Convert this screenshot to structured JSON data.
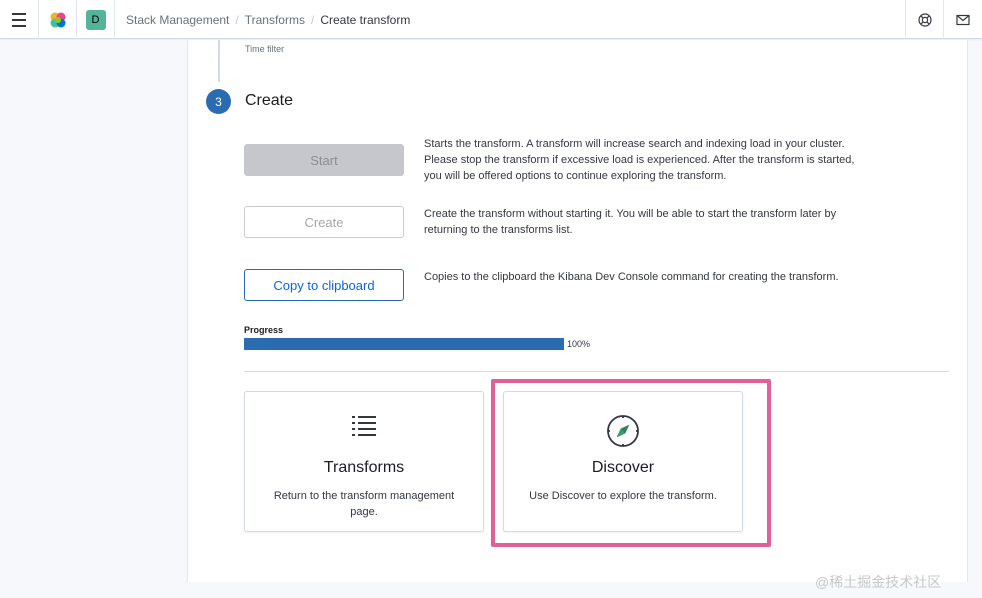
{
  "header": {
    "space_initial": "D",
    "breadcrumbs": [
      "Stack Management",
      "Transforms",
      "Create transform"
    ]
  },
  "steps": {
    "previous_label": "Time filter",
    "current_number": "3",
    "current_title": "Create"
  },
  "actions": {
    "start": {
      "label": "Start",
      "description": "Starts the transform. A transform will increase search and indexing load in your cluster. Please stop the transform if excessive load is experienced. After the transform is started, you will be offered options to continue exploring the transform."
    },
    "create": {
      "label": "Create",
      "description": "Create the transform without starting it. You will be able to start the transform later by returning to the transforms list."
    },
    "copy": {
      "label": "Copy to clipboard",
      "description": "Copies to the clipboard the Kibana Dev Console command for creating the transform."
    }
  },
  "progress": {
    "label": "Progress",
    "value": 100,
    "value_text": "100%"
  },
  "cards": {
    "transforms": {
      "icon": "list-icon",
      "title": "Transforms",
      "description": "Return to the transform management page."
    },
    "discover": {
      "icon": "compass-icon",
      "title": "Discover",
      "description": "Use Discover to explore the transform."
    }
  },
  "watermark": "@稀土掘金技术社区",
  "colors": {
    "primary": "#2b6bb1",
    "highlight": "#e2609a",
    "space_badge": "#54b399"
  }
}
